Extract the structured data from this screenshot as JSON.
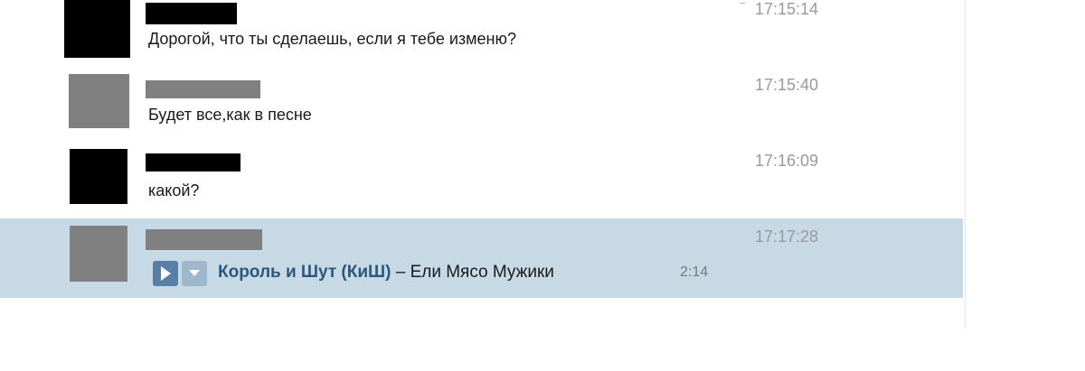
{
  "messages": [
    {
      "author_redacted": true,
      "avatar_color": "#000000",
      "name_color": "#000000",
      "text": "Дорогой, что ты сделаешь, если я тебе изменю?",
      "time": "17:15:14"
    },
    {
      "author_redacted": true,
      "avatar_color": "#808080",
      "name_color": "#808080",
      "text": "Будет все,как в песне",
      "time": "17:15:40"
    },
    {
      "author_redacted": true,
      "avatar_color": "#000000",
      "name_color": "#000000",
      "text": "какой?",
      "time": "17:16:09"
    },
    {
      "author_redacted": true,
      "avatar_color": "#808080",
      "name_color": "#808080",
      "highlighted": true,
      "time": "17:17:28",
      "audio": {
        "artist": "Король и Шут (КиШ)",
        "separator": " – ",
        "title": "Ели Мясо Мужики",
        "duration": "2:14",
        "play_icon": "play-icon",
        "add_icon": "add-dropdown-icon"
      }
    }
  ],
  "colors": {
    "highlight_background": "#c8d9e6",
    "artist_link": "#2b587a",
    "timestamp": "#999999",
    "play_button": "#5a7fa6",
    "add_button": "#9fb7cd"
  }
}
